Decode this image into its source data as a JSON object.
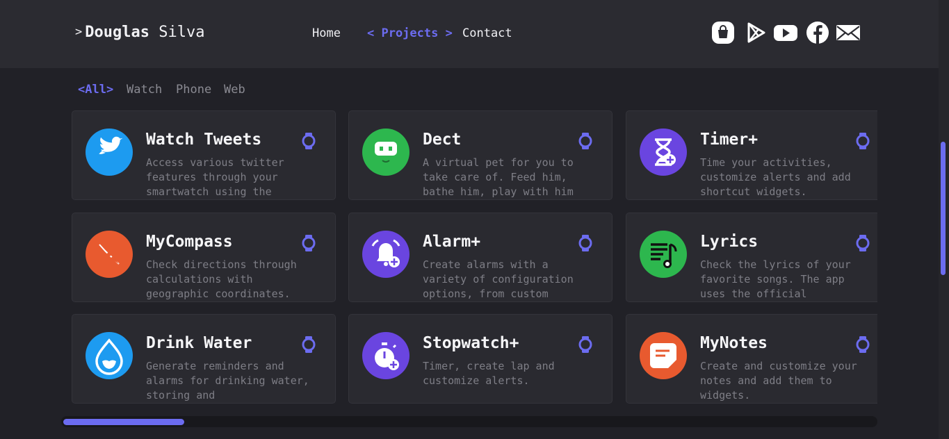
{
  "brand": {
    "caret": ">",
    "first": "Douglas",
    "last": "Silva"
  },
  "nav": {
    "home": "Home",
    "projects": "< Projects >",
    "contact": "Contact"
  },
  "social": [
    {
      "name": "app-store-bag-icon"
    },
    {
      "name": "play-store-icon"
    },
    {
      "name": "youtube-icon"
    },
    {
      "name": "facebook-icon"
    },
    {
      "name": "mail-icon"
    }
  ],
  "filters": {
    "all": "<All>",
    "watch": "Watch",
    "phone": "Phone",
    "web": "Web"
  },
  "colors": {
    "accent": "#6c6cf0",
    "background": "#212127",
    "card": "#2a2a30",
    "header": "#2b2b31"
  },
  "cards": [
    {
      "title": "Watch Tweets",
      "desc": "Access various twitter features through your smartwatch using the",
      "icon": "twitter-bird-icon",
      "color": "#1d9bf0"
    },
    {
      "title": "Dect",
      "desc": "A virtual pet for you to take care of. Feed him, bathe him, play with him",
      "icon": "robot-pet-icon",
      "color": "#2db74e"
    },
    {
      "title": "Timer+",
      "desc": "Time your activities, customize alerts and add shortcut widgets.",
      "icon": "hourglass-icon",
      "color": "#6a45e0"
    },
    {
      "title": "MyCompass",
      "desc": "Check directions through calculations with geographic coordinates.",
      "icon": "compass-icon",
      "color": "#e85a2f"
    },
    {
      "title": "Alarm+",
      "desc": "Create alarms with a variety of configuration options, from custom",
      "icon": "alarm-bell-icon",
      "color": "#6a45e0"
    },
    {
      "title": "Lyrics",
      "desc": "Check the lyrics of your favorite songs. The app uses the official",
      "icon": "lyrics-note-icon",
      "color": "#2db74e"
    },
    {
      "title": "Drink Water",
      "desc": "Generate reminders and alarms for drinking water, storing and",
      "icon": "water-drop-icon",
      "color": "#1d9bf0"
    },
    {
      "title": "Stopwatch+",
      "desc": "Timer, create lap and customize alerts.",
      "icon": "stopwatch-icon",
      "color": "#6a45e0"
    },
    {
      "title": "MyNotes",
      "desc": "Create and customize your notes and add them to widgets.",
      "icon": "note-icon",
      "color": "#e85a2f"
    }
  ]
}
